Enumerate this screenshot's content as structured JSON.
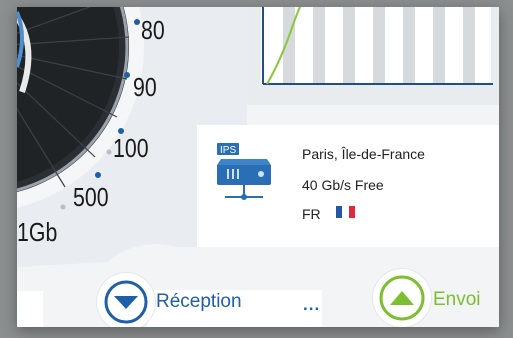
{
  "gauge": {
    "tick_labels": [
      "80",
      "90",
      "100",
      "500",
      "1Gb"
    ]
  },
  "server": {
    "badge": "IPS",
    "location": "Paris, Île-de-France",
    "bandwidth": "40 Gb/s Free",
    "country_code": "FR",
    "flag_colors": [
      "#2456a6",
      "#ffffff",
      "#e0283a"
    ]
  },
  "actions": {
    "reception_label": "Réception",
    "more_label": "...",
    "envoi_label": "Envoi"
  },
  "colors": {
    "accent_blue": "#1f5fa8",
    "accent_green": "#7cbf2f",
    "gauge_dark": "#1f2326"
  }
}
